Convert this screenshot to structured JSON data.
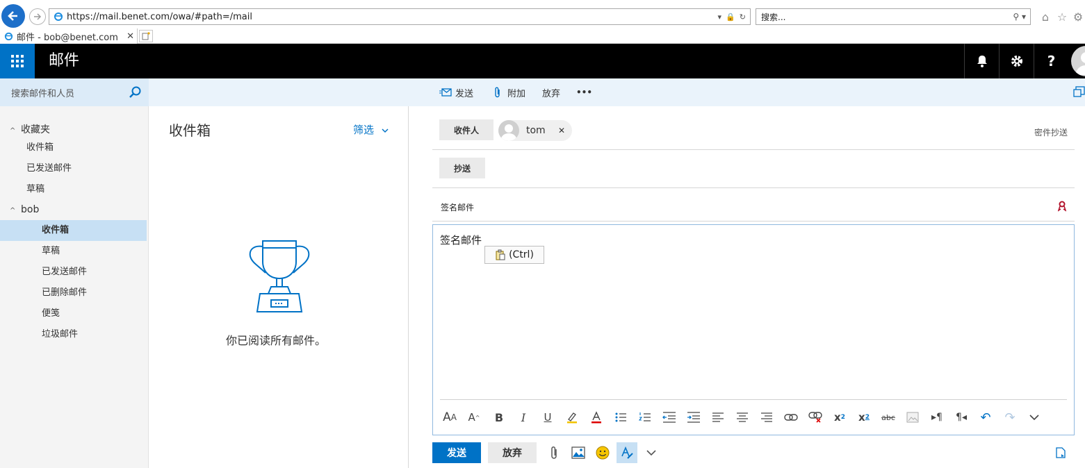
{
  "browser": {
    "url": "https://mail.benet.com/owa/#path=/mail",
    "search_placeholder": "搜索...",
    "tab_title": "邮件 - bob@benet.com"
  },
  "suite": {
    "app_title": "邮件"
  },
  "command_bar": {
    "search_placeholder": "搜索邮件和人员",
    "send": "发送",
    "attach": "附加",
    "discard": "放弃",
    "more": "•••"
  },
  "nav": {
    "favorites": "收藏夹",
    "favorites_items": [
      "收件箱",
      "已发送邮件",
      "草稿"
    ],
    "account": "bob",
    "account_items": [
      "收件箱",
      "草稿",
      "已发送邮件",
      "已删除邮件",
      "便笺",
      "垃圾邮件"
    ]
  },
  "list": {
    "title": "收件箱",
    "filter": "筛选",
    "empty": "你已阅读所有邮件。"
  },
  "compose": {
    "to_label": "收件人",
    "recipient": "tom",
    "bcc_link": "密件抄送",
    "cc_label": "抄送",
    "subject": "签名邮件",
    "body": "签名邮件",
    "paste_popup": "(Ctrl)",
    "send_button": "发送",
    "discard_button": "放弃"
  },
  "colors": {
    "accent": "#0072c6",
    "suite_bg": "#000000",
    "selected": "#c7e0f4"
  }
}
